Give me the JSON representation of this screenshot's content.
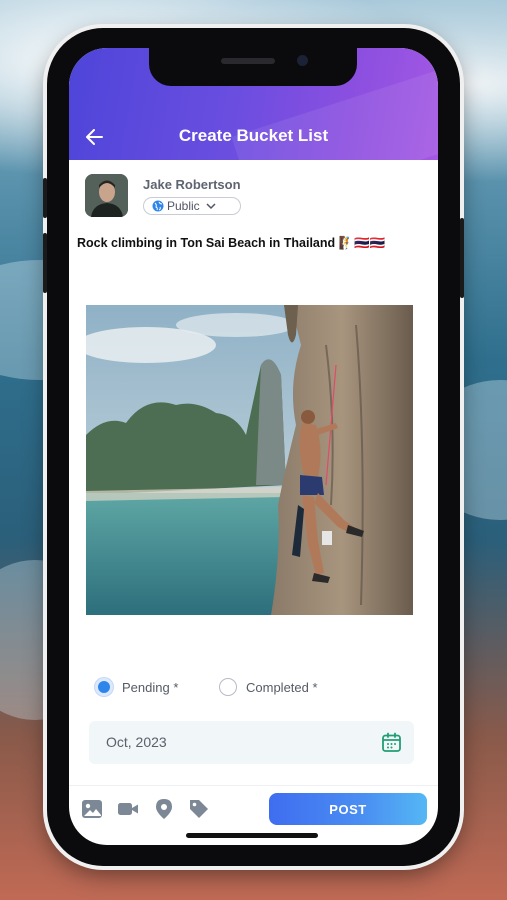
{
  "header": {
    "title": "Create Bucket List",
    "back_icon": "arrow-left-icon"
  },
  "user": {
    "name": "Jake Robertson",
    "privacy": "Public",
    "privacy_icon": "globe-icon",
    "dropdown_icon": "chevron-down-icon"
  },
  "post": {
    "text": "Rock climbing in Ton Sai Beach in Thailand",
    "emojis": "🧗🇹🇭🇹🇭"
  },
  "status": {
    "options": [
      {
        "label": "Pending *",
        "selected": true
      },
      {
        "label": "Completed *",
        "selected": false
      }
    ]
  },
  "date": {
    "value": "Oct, 2023",
    "icon": "calendar-icon"
  },
  "toolbar": {
    "icons": [
      "image-icon",
      "video-icon",
      "location-pin-icon",
      "tag-icon"
    ],
    "post_label": "POST"
  },
  "colors": {
    "accent": "#2f86ea",
    "header_start": "#4e45d9",
    "header_end": "#a458e3",
    "calendar": "#1f9e73"
  }
}
